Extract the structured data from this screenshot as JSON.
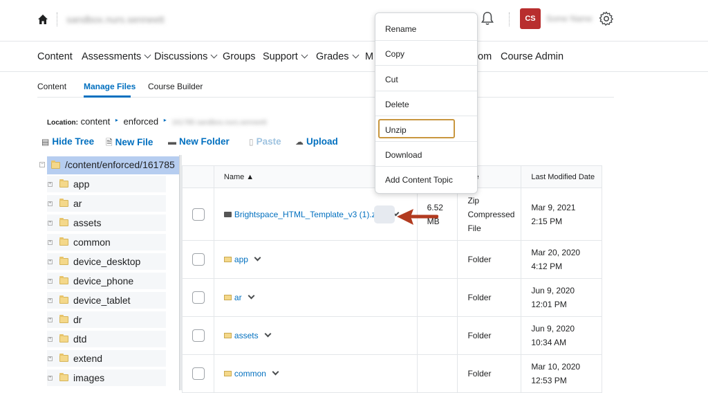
{
  "topbar": {
    "org_name": "sandbox.nurs.senneett",
    "avatar_initials": "CS",
    "avatar_color": "#b82e2e",
    "user_name": "Some Name",
    "icons": [
      "home-icon",
      "mail-icon",
      "bell-icon",
      "gear-icon"
    ]
  },
  "nav": {
    "items": [
      {
        "label": "Content",
        "has_menu": false
      },
      {
        "label": "Assessments",
        "has_menu": true
      },
      {
        "label": "Discussions",
        "has_menu": true
      },
      {
        "label": "Groups",
        "has_menu": false
      },
      {
        "label": "Support",
        "has_menu": true
      },
      {
        "label": "Grades",
        "has_menu": true
      },
      {
        "label": "M",
        "has_menu": false
      },
      {
        "label": "om",
        "has_menu": false
      },
      {
        "label": "Course Admin",
        "has_menu": false
      }
    ]
  },
  "subnav": {
    "items": [
      "Content",
      "Manage Files",
      "Course Builder"
    ],
    "active": "Manage Files"
  },
  "location": {
    "label": "Location:",
    "parts": [
      "content",
      "enforced"
    ],
    "blurred": "161785 sandbox.nurs.senneett"
  },
  "toolbar": {
    "hide_tree": "Hide Tree",
    "new_file": "New File",
    "new_folder": "New Folder",
    "paste": "Paste",
    "upload": "Upload"
  },
  "tree": {
    "root": "/content/enforced/161785",
    "items": [
      "app",
      "ar",
      "assets",
      "common",
      "device_desktop",
      "device_phone",
      "device_tablet",
      "dr",
      "dtd",
      "extend",
      "images"
    ]
  },
  "table": {
    "headers": {
      "name": "Name ▲",
      "size": "",
      "type": "e",
      "modified": "Last Modified Date"
    },
    "rows": [
      {
        "name": "Brightspace_HTML_Template_v3 (1).zip",
        "size_l1": "6.52",
        "size_l2": "MB",
        "type_l1": "Zip",
        "type_l2": "Compressed",
        "type_l3": "File",
        "date_l1": "Mar 9, 2021",
        "date_l2": "2:15 PM",
        "kind": "zip"
      },
      {
        "name": "app",
        "type": "Folder",
        "date_l1": "Mar 20, 2020",
        "date_l2": "4:12 PM",
        "kind": "folder"
      },
      {
        "name": "ar",
        "type": "Folder",
        "date_l1": "Jun 9, 2020",
        "date_l2": "12:01 PM",
        "kind": "folder"
      },
      {
        "name": "assets",
        "type": "Folder",
        "date_l1": "Jun 9, 2020",
        "date_l2": "10:34 AM",
        "kind": "folder"
      },
      {
        "name": "common",
        "type": "Folder",
        "date_l1": "Mar 10, 2020",
        "date_l2": "12:53 PM",
        "kind": "folder"
      }
    ]
  },
  "context_menu": {
    "items": [
      "Rename",
      "Copy",
      "Cut",
      "Delete",
      "Unzip",
      "Download",
      "Add Content Topic"
    ],
    "highlighted": "Unzip"
  },
  "colors": {
    "link": "#006fbf",
    "tree_selected": "#b6cdf0",
    "highlight_border": "#c8963e",
    "arrow": "#b23b20"
  }
}
